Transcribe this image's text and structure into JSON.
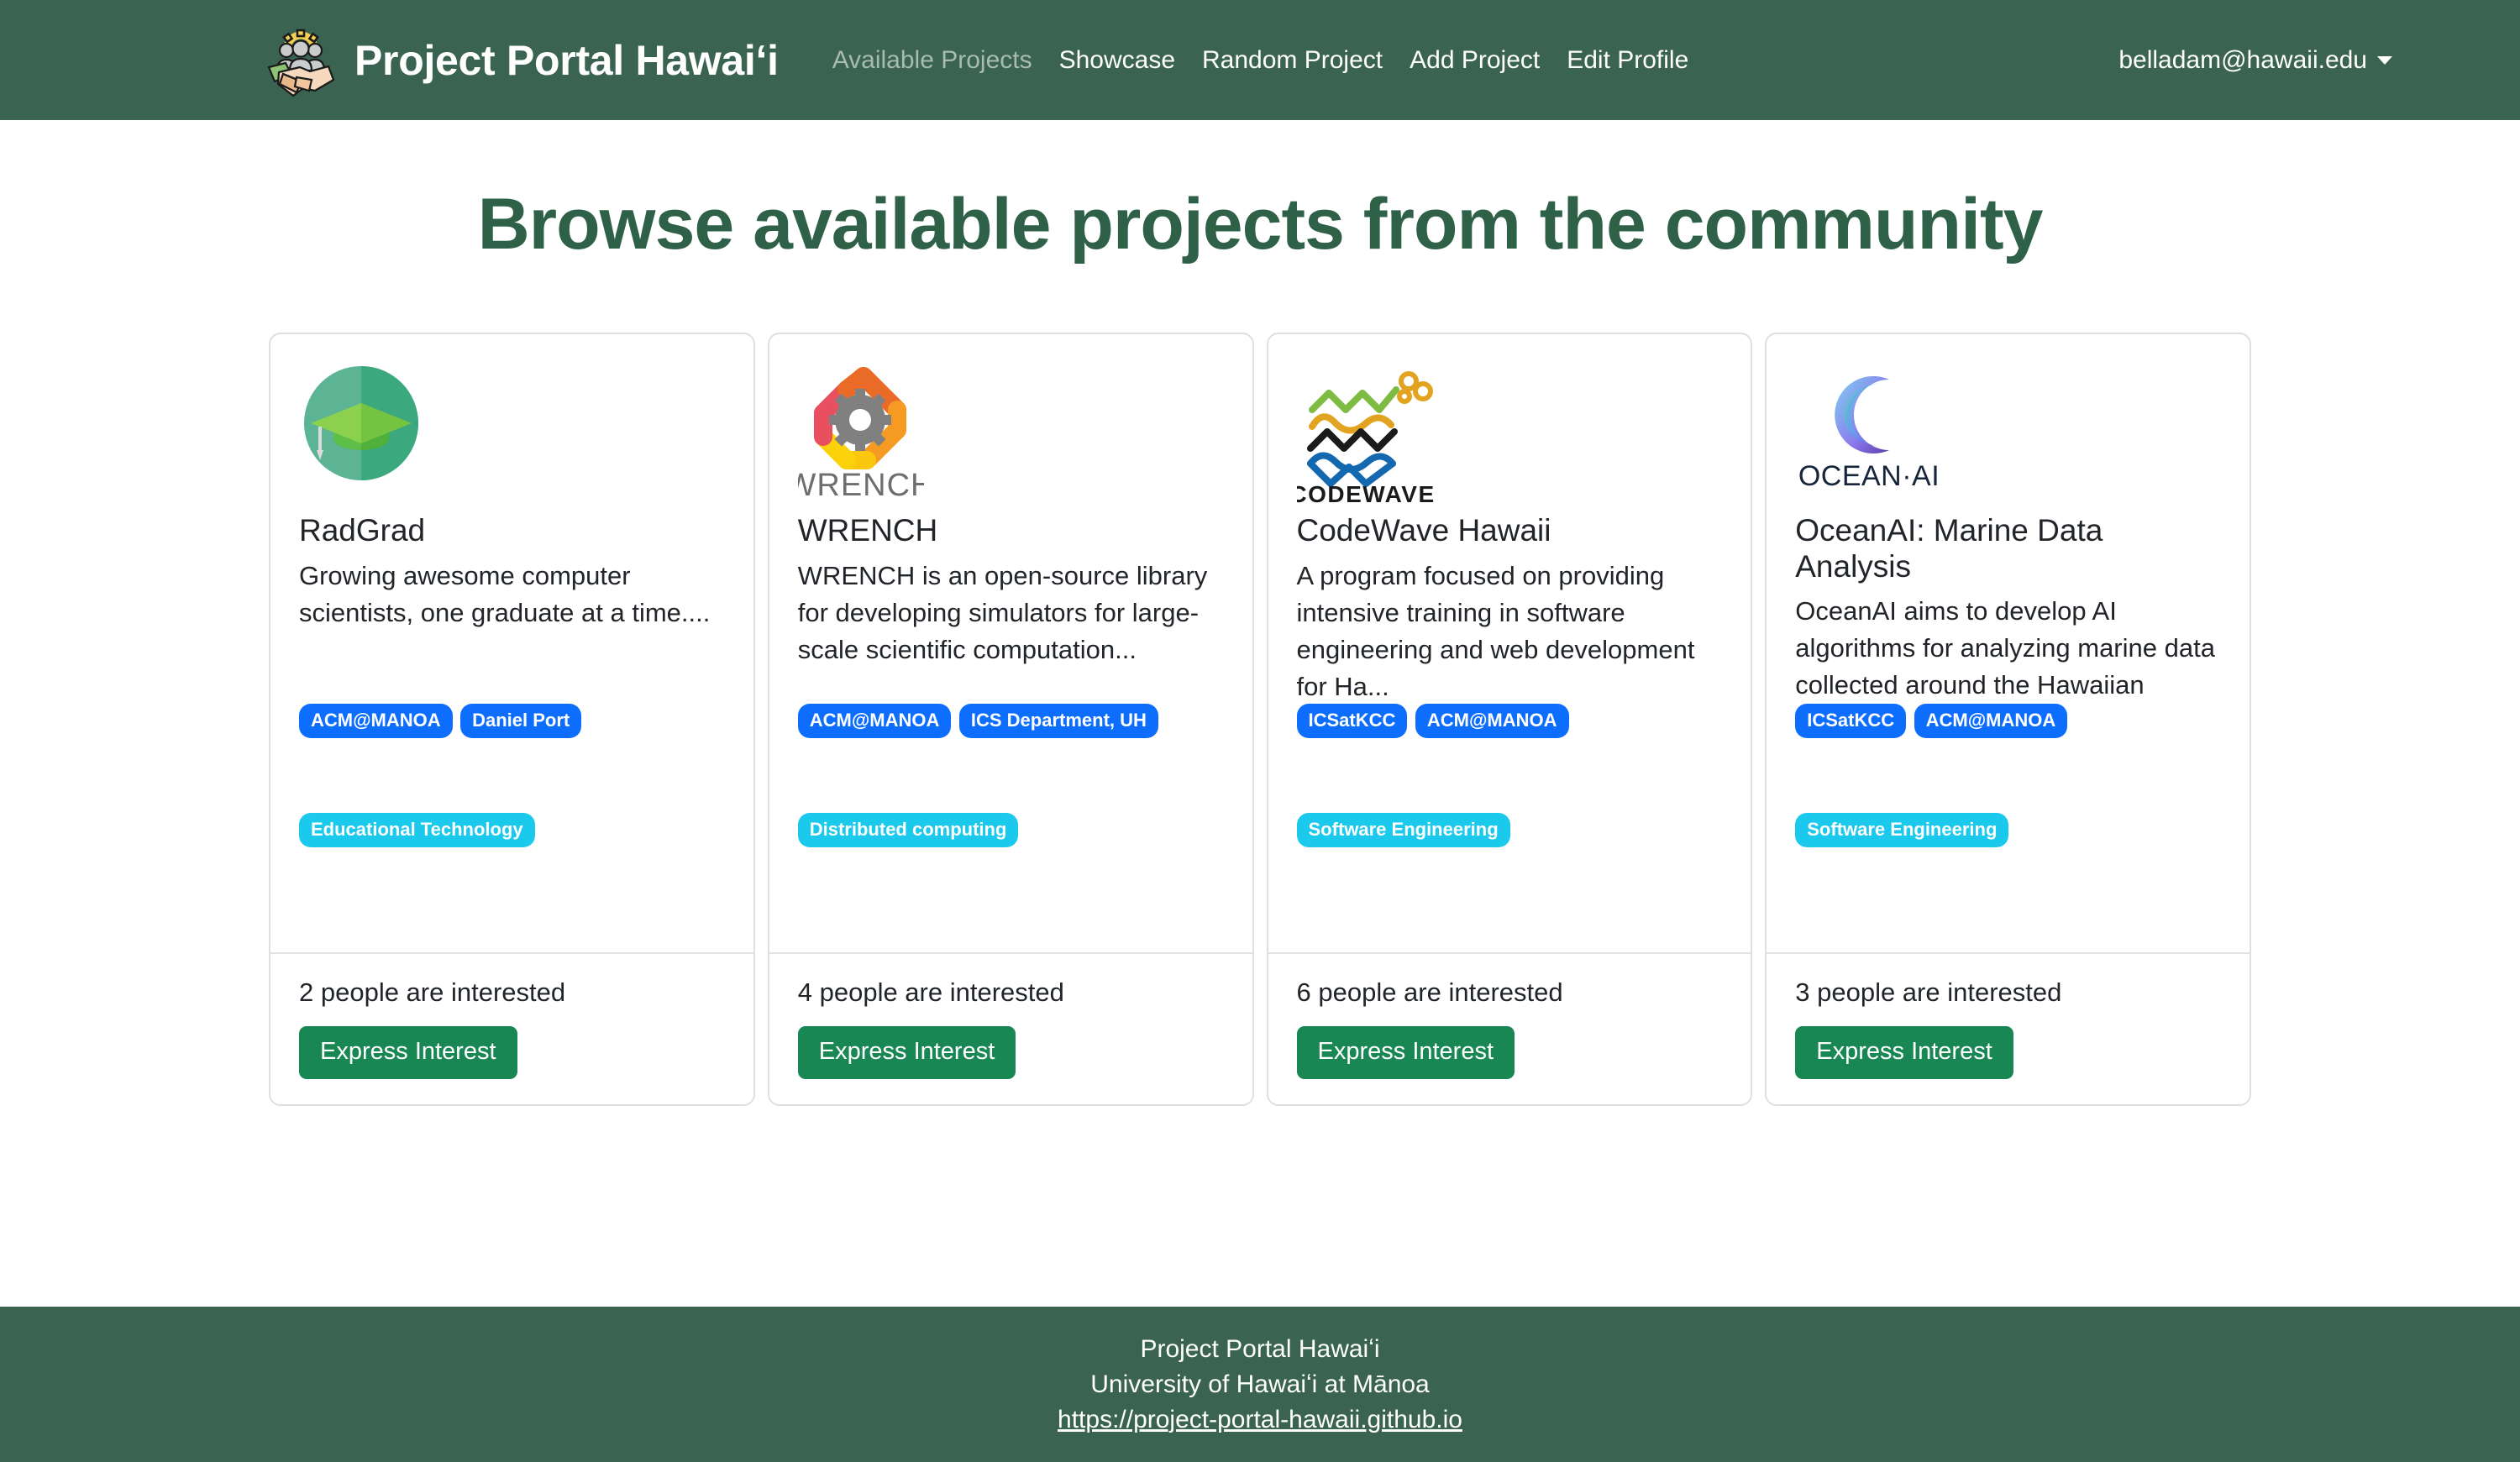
{
  "navbar": {
    "brand": "Project Portal Hawaiʻi",
    "logo_icon": "handshake-people-gear-logo",
    "links": [
      {
        "label": "Available Projects",
        "active": true
      },
      {
        "label": "Showcase",
        "active": false
      },
      {
        "label": "Random Project",
        "active": false
      },
      {
        "label": "Add Project",
        "active": false
      },
      {
        "label": "Edit Profile",
        "active": false
      }
    ],
    "user_email": "belladam@hawaii.edu",
    "caret_icon": "chevron-down-icon",
    "background_color": "#3A6351"
  },
  "page": {
    "title": "Browse available projects from the community",
    "title_color": "#2E6148"
  },
  "cards": [
    {
      "logo_icon": "radgrad-graduation-cap-logo",
      "title": "RadGrad",
      "description": "Growing awesome computer scientists, one graduate at a time....",
      "interests": [
        "ACM@MANOA",
        "Daniel Port"
      ],
      "topics": [
        "Educational Technology"
      ],
      "interest_count_text": "2 people are interested",
      "button_label": "Express Interest"
    },
    {
      "logo_icon": "wrench-gear-logo",
      "title": "WRENCH",
      "description": "WRENCH is an open-source library for developing simulators for large-scale scientific computation...",
      "interests": [
        "ACM@MANOA",
        "ICS Department, UH"
      ],
      "topics": [
        "Distributed computing"
      ],
      "interest_count_text": "4 people are interested",
      "button_label": "Express Interest"
    },
    {
      "logo_icon": "codewave-hawaii-waves-logo",
      "title": "CodeWave Hawaii",
      "description": "A program focused on providing intensive training in software engineering and web development for Ha...",
      "interests": [
        "ICSatKCC",
        "ACM@MANOA"
      ],
      "topics": [
        "Software Engineering"
      ],
      "interest_count_text": "6 people are interested",
      "button_label": "Express Interest"
    },
    {
      "logo_icon": "oceanai-crescent-logo",
      "title": "OceanAI: Marine Data Analysis",
      "description": "OceanAI aims to develop AI algorithms for analyzing marine data collected around the Hawaiian island...",
      "interests": [
        "ICSatKCC",
        "ACM@MANOA"
      ],
      "topics": [
        "Software Engineering"
      ],
      "interest_count_text": "3 people are interested",
      "button_label": "Express Interest"
    }
  ],
  "footer": {
    "line1": "Project Portal Hawaiʻi",
    "line2": "University of Hawaiʻi at Mānoa",
    "link": "https://project-portal-hawaii.github.io",
    "background_color": "#3A6351"
  },
  "colors": {
    "brand_green": "#3A6351",
    "heading_green": "#2E6148",
    "badge_blue": "#0D6EFD",
    "badge_cyan": "#1BC9EC",
    "button_green": "#198754"
  }
}
